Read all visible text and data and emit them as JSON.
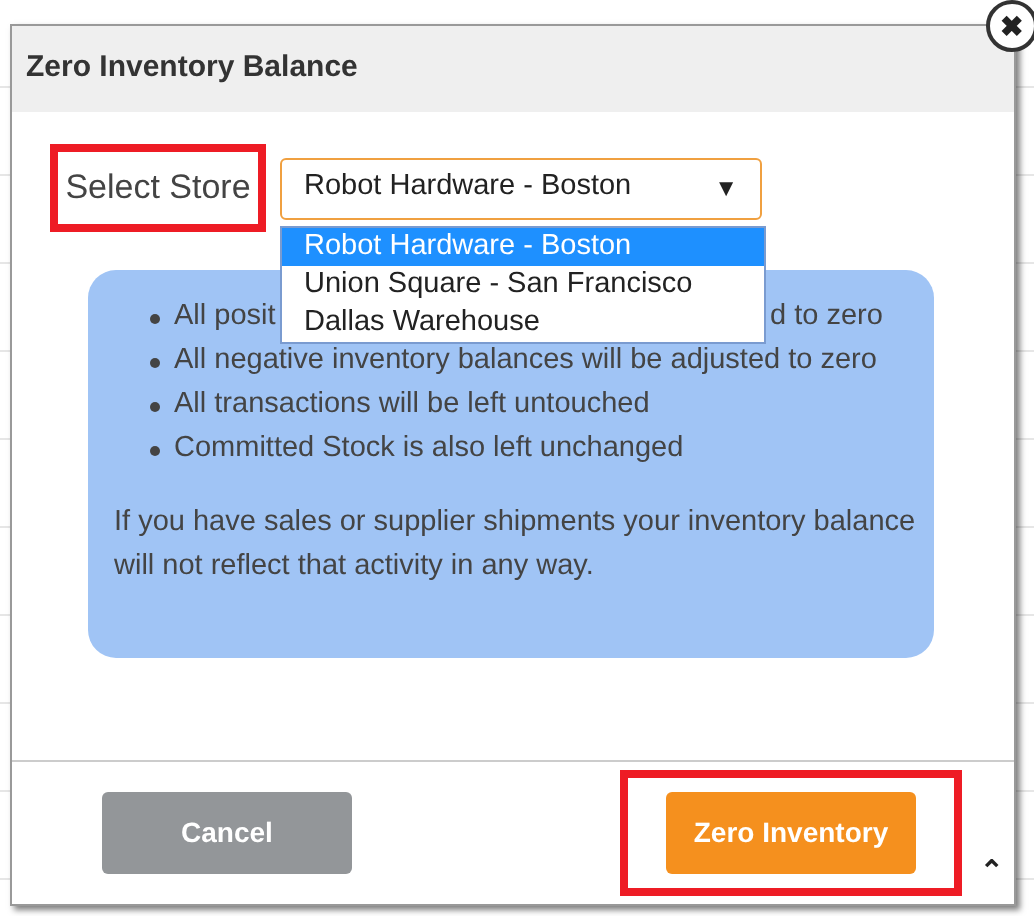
{
  "dialog": {
    "title": "Zero Inventory Balance",
    "close_icon": "✖"
  },
  "store_select": {
    "label": "Select Store",
    "label_highlighted": true,
    "value": "Robot Hardware - Boston",
    "caret": "▼",
    "expanded": true,
    "options": [
      {
        "label": "Robot Hardware - Boston",
        "selected": true
      },
      {
        "label": "Union Square - San Francisco",
        "selected": false
      },
      {
        "label": "Dallas Warehouse",
        "selected": false
      }
    ]
  },
  "info": {
    "bullets": [
      {
        "visible_start": "All posit",
        "visible_end": "d to zero"
      },
      {
        "text": "All negative inventory balances will be adjusted to zero"
      },
      {
        "text": "All transactions will be left untouched"
      },
      {
        "text": "Committed Stock is also left unchanged"
      }
    ],
    "note": "If you have sales or supplier shipments your inventory balance will not reflect that activity in any way."
  },
  "buttons": [
    {
      "label": "Cancel",
      "kind": "secondary",
      "highlighted": false
    },
    {
      "label": "Zero Inventory",
      "kind": "primary",
      "highlighted": true
    }
  ],
  "scroll_icon": "⌃"
}
